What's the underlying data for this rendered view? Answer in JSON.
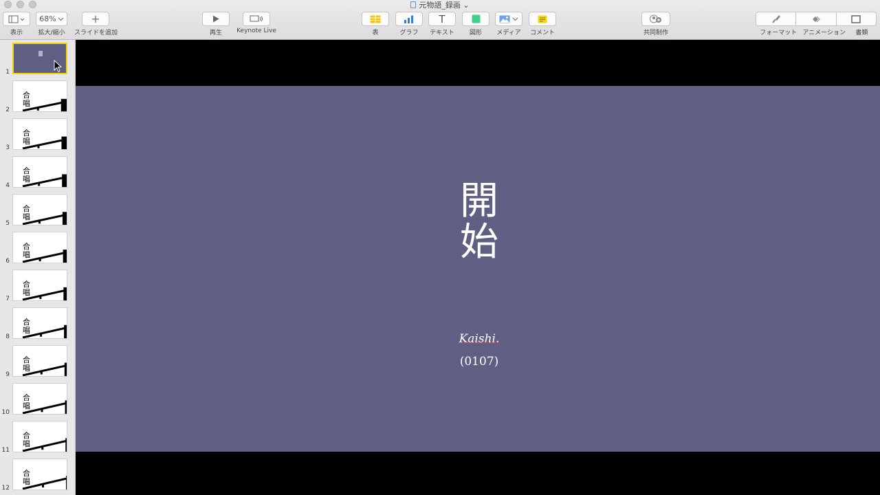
{
  "window": {
    "title": "元物語_録画 ⌄"
  },
  "toolbar": {
    "view_label": "表示",
    "zoom_value": "68%",
    "zoom_label": "拡大/縮小",
    "add_slide_label": "スライドを追加",
    "play_label": "再生",
    "keynote_live_label": "Keynote Live",
    "table_label": "表",
    "chart_label": "グラフ",
    "text_label": "テキスト",
    "shape_label": "図形",
    "media_label": "メディア",
    "comment_label": "コメント",
    "collaborate_label": "共同制作",
    "format_label": "フォーマット",
    "animate_label": "アニメーション",
    "document_label": "書類",
    "text_glyph": "T",
    "add_glyph": "+"
  },
  "navigator": {
    "selected": 1,
    "slides": [
      {
        "num": "1",
        "kind": "title"
      },
      {
        "num": "2",
        "kanji": "合唱"
      },
      {
        "num": "3",
        "kanji": "合唱"
      },
      {
        "num": "4",
        "kanji": "合唱"
      },
      {
        "num": "5",
        "kanji": "合唱"
      },
      {
        "num": "6",
        "kanji": "合唱"
      },
      {
        "num": "7",
        "kanji": "合唱"
      },
      {
        "num": "8",
        "kanji": "合唱"
      },
      {
        "num": "9",
        "kanji": "合唱"
      },
      {
        "num": "10",
        "kanji": "合唱"
      },
      {
        "num": "11",
        "kanji": "合唱"
      },
      {
        "num": "12",
        "kanji": "合唱"
      }
    ]
  },
  "slide": {
    "title": "開始",
    "subtitle": "Kaishi.",
    "code": "(0107)",
    "background": "#5f5f84"
  },
  "colors": {
    "selection": "#f5d400",
    "table_icon": "#f3c316",
    "chart_icon": "#2f7fd8",
    "shape_icon": "#3fd08a",
    "comment_icon": "#f6d80a"
  }
}
